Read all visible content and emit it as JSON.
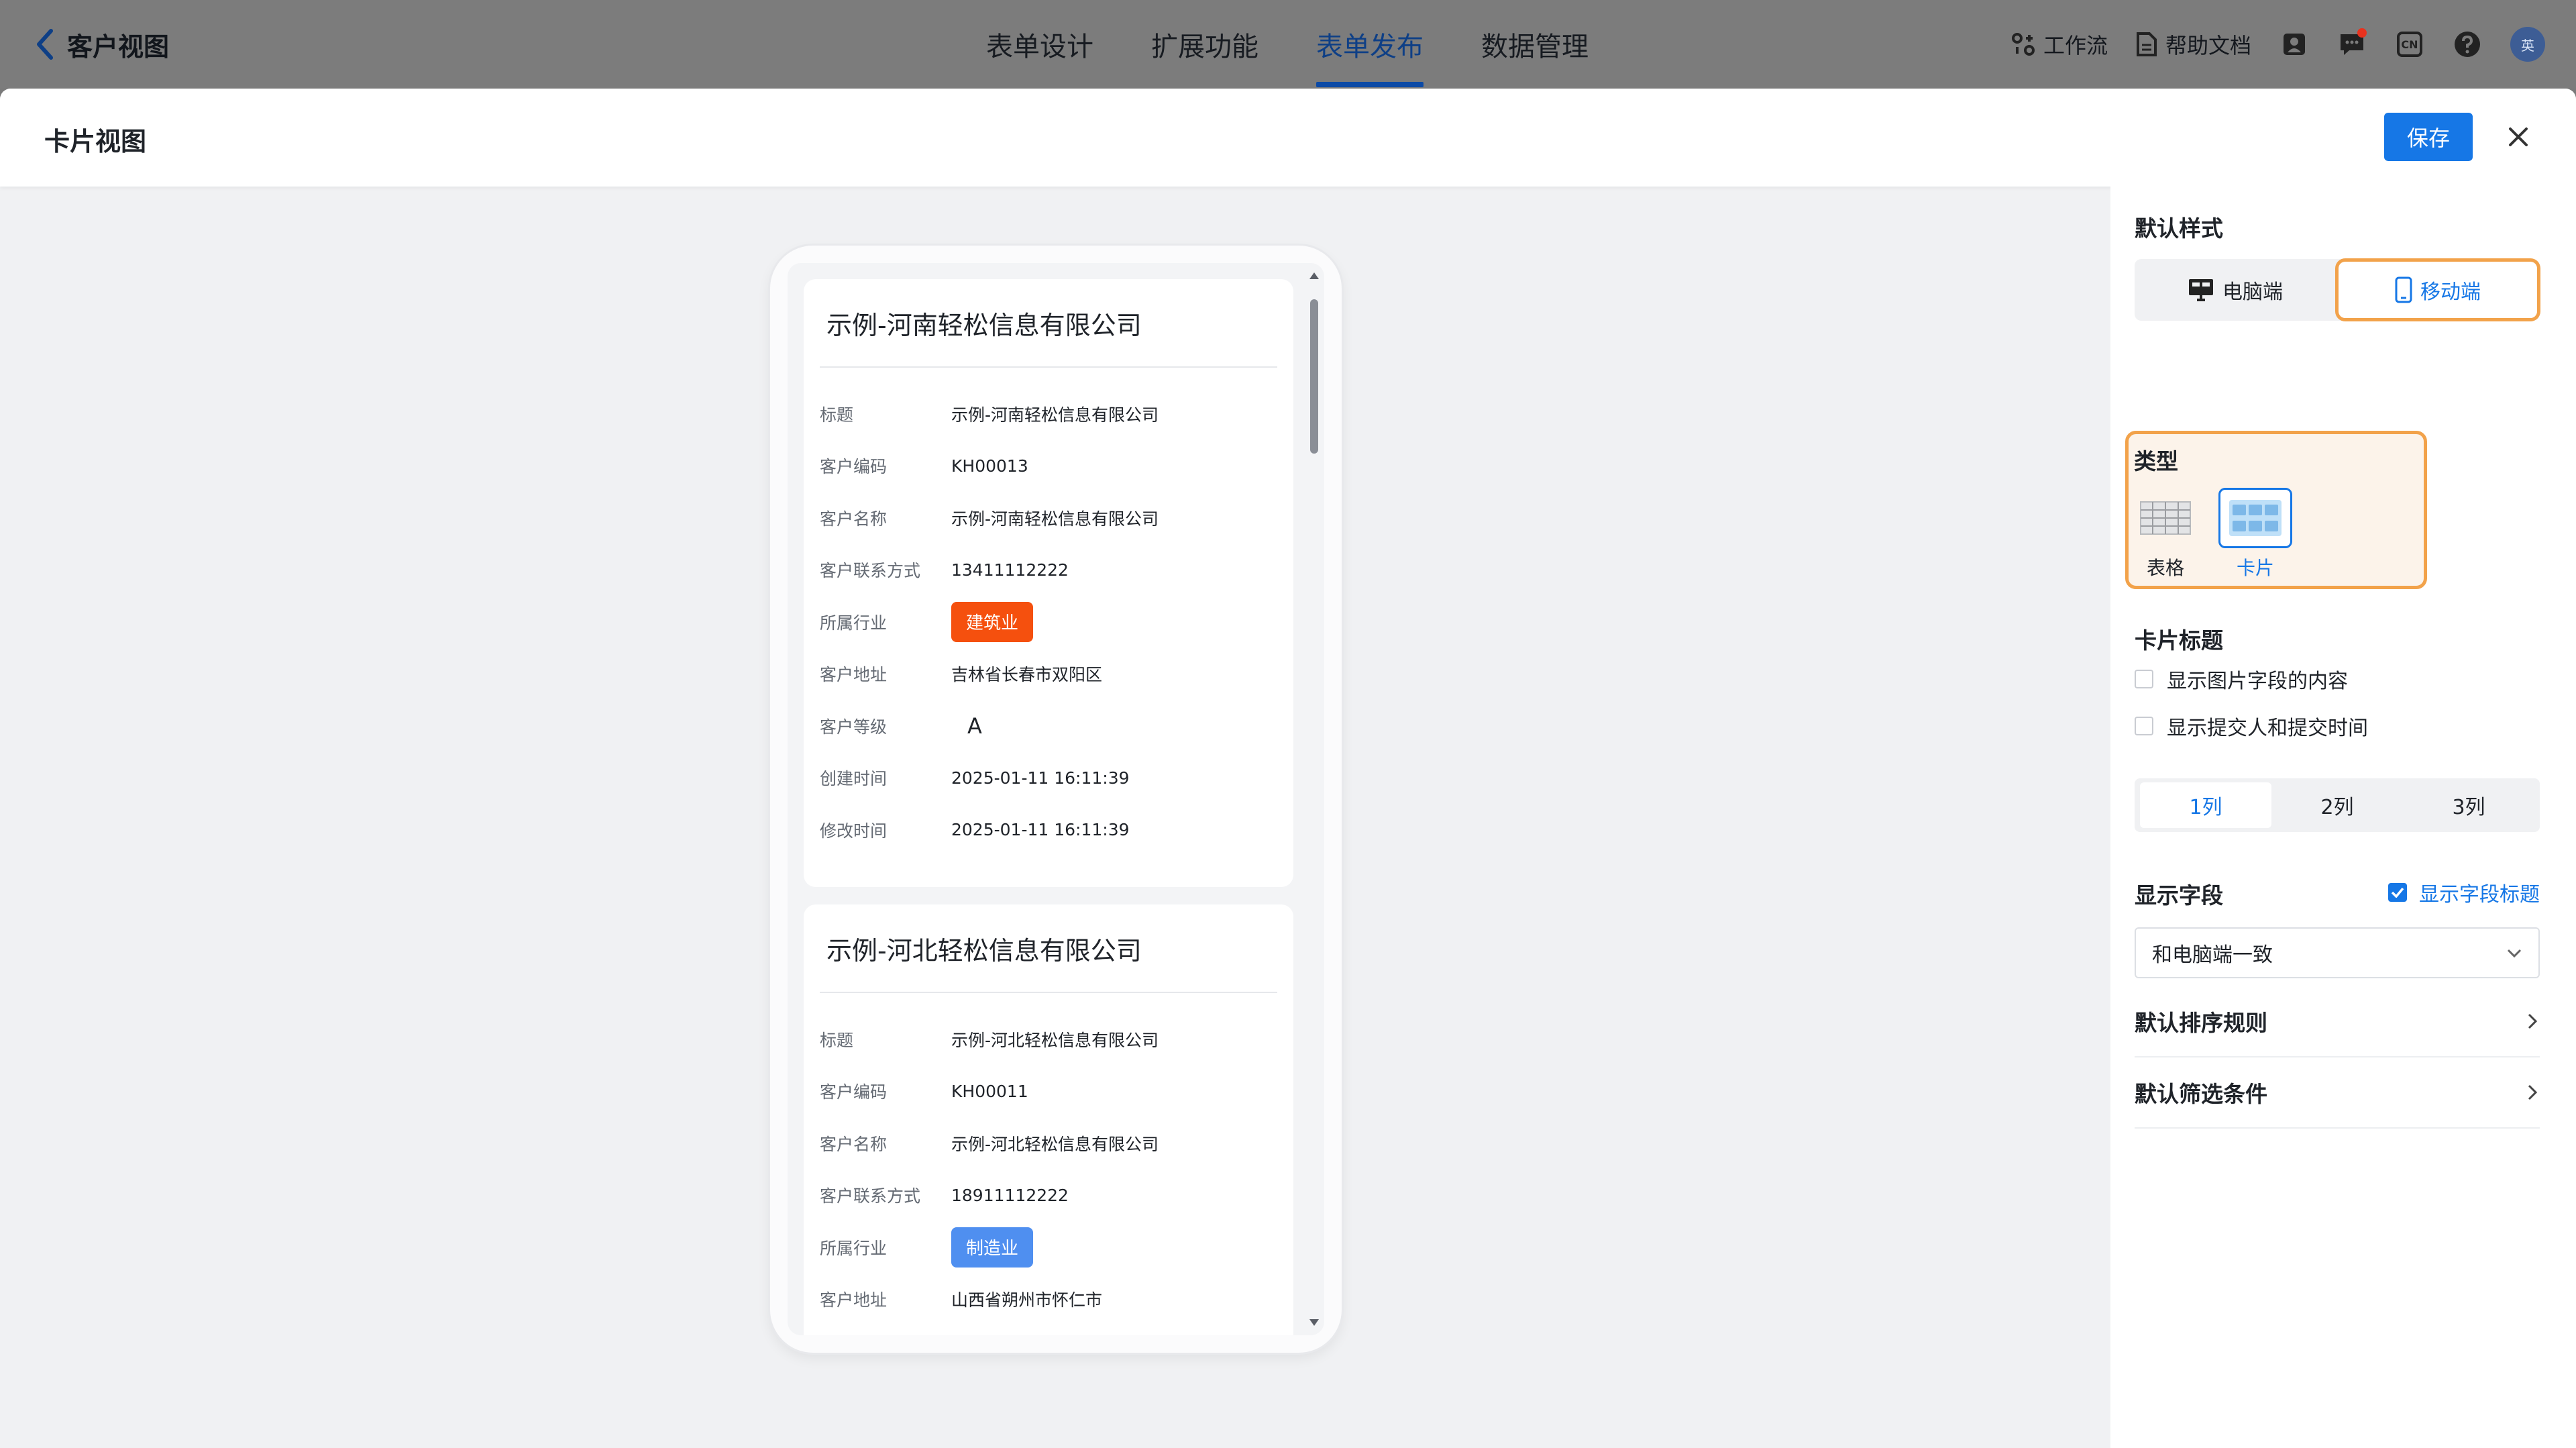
{
  "app": {
    "back_label": "客户视图",
    "tabs": [
      {
        "label": "表单设计",
        "active": false
      },
      {
        "label": "扩展功能",
        "active": false
      },
      {
        "label": "表单发布",
        "active": true
      },
      {
        "label": "数据管理",
        "active": false
      }
    ],
    "workflow_label": "工作流",
    "help_docs_label": "帮助文档",
    "language_badge": "CN",
    "avatar_text": "英"
  },
  "modal": {
    "title": "卡片视图",
    "save_label": "保存"
  },
  "preview": {
    "cards": [
      {
        "title": "示例-河南轻松信息有限公司",
        "fields": [
          {
            "label": "标题",
            "value": "示例-河南轻松信息有限公司"
          },
          {
            "label": "客户编码",
            "value": "KH00013"
          },
          {
            "label": "客户名称",
            "value": "示例-河南轻松信息有限公司"
          },
          {
            "label": "客户联系方式",
            "value": "13411112222"
          },
          {
            "label": "所属行业",
            "value": "建筑业",
            "kind": "tag",
            "color": "#f5500e"
          },
          {
            "label": "客户地址",
            "value": "吉林省长春市双阳区"
          },
          {
            "label": "客户等级",
            "value": "A",
            "kind": "grade"
          },
          {
            "label": "创建时间",
            "value": "2025-01-11 16:11:39"
          },
          {
            "label": "修改时间",
            "value": "2025-01-11 16:11:39"
          }
        ]
      },
      {
        "title": "示例-河北轻松信息有限公司",
        "fields": [
          {
            "label": "标题",
            "value": "示例-河北轻松信息有限公司"
          },
          {
            "label": "客户编码",
            "value": "KH00011"
          },
          {
            "label": "客户名称",
            "value": "示例-河北轻松信息有限公司"
          },
          {
            "label": "客户联系方式",
            "value": "18911112222"
          },
          {
            "label": "所属行业",
            "value": "制造业",
            "kind": "tag",
            "color": "#4f8ff0"
          },
          {
            "label": "客户地址",
            "value": "山西省朔州市怀仁市"
          }
        ]
      }
    ]
  },
  "panel": {
    "default_style_title": "默认样式",
    "device_options": [
      {
        "label": "电脑端",
        "active": false
      },
      {
        "label": "移动端",
        "active": true
      }
    ],
    "type_title": "类型",
    "type_options": [
      {
        "label": "表格",
        "active": false
      },
      {
        "label": "卡片",
        "active": true
      }
    ],
    "card_title_heading": "卡片标题",
    "card_title_options": [
      {
        "label": "显示图片字段的内容",
        "checked": false
      },
      {
        "label": "显示提交人和提交时间",
        "checked": false
      }
    ],
    "column_options": [
      {
        "label": "1列",
        "active": true
      },
      {
        "label": "2列",
        "active": false
      },
      {
        "label": "3列",
        "active": false
      }
    ],
    "display_fields_title": "显示字段",
    "show_field_title_label": "显示字段标题",
    "show_field_title_checked": true,
    "display_fields_value": "和电脑端一致",
    "sort_rule_label": "默认排序规则",
    "filter_label": "默认筛选条件"
  },
  "colors": {
    "accent": "#1677e6",
    "highlight_border": "#f2a24a"
  }
}
